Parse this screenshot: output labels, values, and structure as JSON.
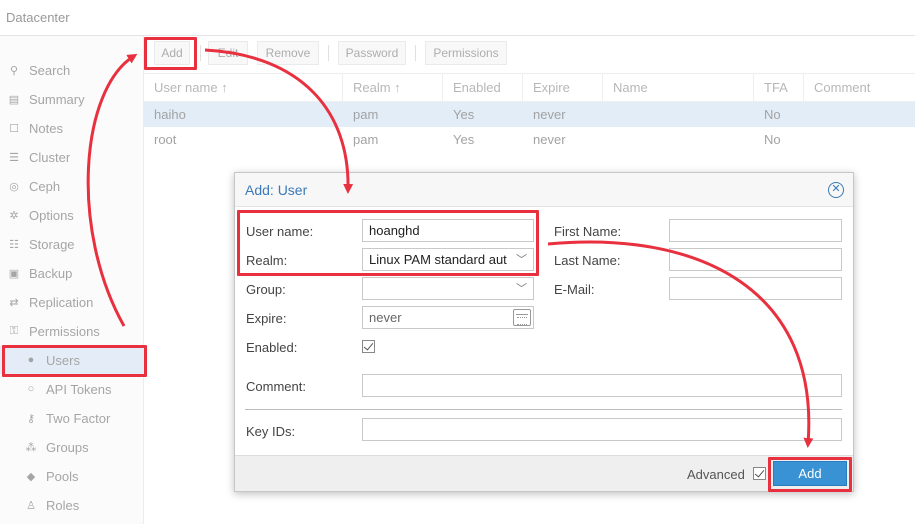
{
  "header": {
    "title": "Datacenter"
  },
  "sidebar": {
    "items": [
      {
        "label": "Search",
        "icon": "search-icon",
        "glyph": "⚲"
      },
      {
        "label": "Summary",
        "icon": "book-icon",
        "glyph": "▤"
      },
      {
        "label": "Notes",
        "icon": "note-icon",
        "glyph": "☐"
      },
      {
        "label": "Cluster",
        "icon": "server-icon",
        "glyph": "☰"
      },
      {
        "label": "Ceph",
        "icon": "ceph-icon",
        "glyph": "◎"
      },
      {
        "label": "Options",
        "icon": "gear-icon",
        "glyph": "✲"
      },
      {
        "label": "Storage",
        "icon": "database-icon",
        "glyph": "☷"
      },
      {
        "label": "Backup",
        "icon": "floppy-icon",
        "glyph": "▣"
      },
      {
        "label": "Replication",
        "icon": "retweet-icon",
        "glyph": "⇄"
      },
      {
        "label": "Permissions",
        "icon": "unlock-icon",
        "glyph": "⚿"
      },
      {
        "label": "Users",
        "icon": "user-icon",
        "glyph": "●"
      },
      {
        "label": "API Tokens",
        "icon": "user-outline-icon",
        "glyph": "○"
      },
      {
        "label": "Two Factor",
        "icon": "key-icon",
        "glyph": "⚷"
      },
      {
        "label": "Groups",
        "icon": "users-icon",
        "glyph": "⁂"
      },
      {
        "label": "Pools",
        "icon": "tags-icon",
        "glyph": "◆"
      },
      {
        "label": "Roles",
        "icon": "male-icon",
        "glyph": "♙"
      }
    ],
    "selected": "Users"
  },
  "toolbar": {
    "add": "Add",
    "edit": "Edit",
    "remove": "Remove",
    "password": "Password",
    "permissions": "Permissions"
  },
  "grid": {
    "columns": [
      "User name ↑",
      "Realm ↑",
      "Enabled",
      "Expire",
      "Name",
      "TFA",
      "Comment"
    ],
    "rows": [
      [
        "haiho",
        "pam",
        "Yes",
        "never",
        "",
        "No",
        ""
      ],
      [
        "root",
        "pam",
        "Yes",
        "never",
        "",
        "No",
        ""
      ]
    ]
  },
  "dialog": {
    "title": "Add: User",
    "close_icon": "close-icon",
    "username_label": "User name:",
    "username_value": "hoanghd",
    "realm_label": "Realm:",
    "realm_value": "Linux PAM standard aut",
    "group_label": "Group:",
    "group_value": "",
    "expire_label": "Expire:",
    "expire_value": "never",
    "enabled_label": "Enabled:",
    "enabled_checked": true,
    "firstname_label": "First Name:",
    "lastname_label": "Last Name:",
    "email_label": "E-Mail:",
    "comment_label": "Comment:",
    "keyids_label": "Key IDs:",
    "advanced_label": "Advanced",
    "advanced_checked": true,
    "add_label": "Add"
  },
  "colors": {
    "accent": "#3892d4",
    "annotation": "#e8303f",
    "title": "#3a7ab8"
  }
}
